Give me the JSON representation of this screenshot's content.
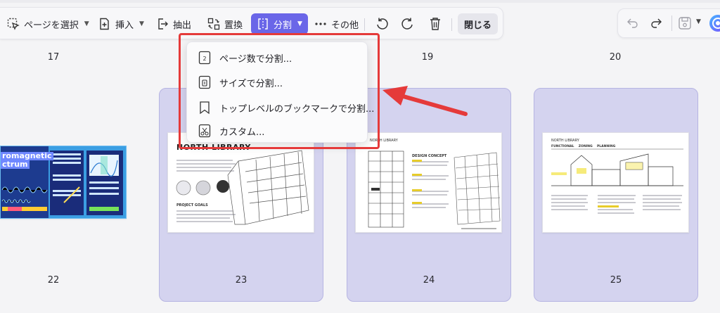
{
  "toolbar": {
    "select_page_label": "ページを選択",
    "insert_label": "挿入",
    "extract_label": "抽出",
    "replace_label": "置換",
    "split_label": "分割",
    "more_label": "その他",
    "close_label": "閉じる"
  },
  "split_menu": {
    "items": [
      {
        "label": "ページ数で分割..."
      },
      {
        "label": "サイズで分割..."
      },
      {
        "label": "トップレベルのブックマークで分割..."
      },
      {
        "label": "カスタム..."
      }
    ]
  },
  "pages": {
    "row1": [
      "17",
      "19",
      "20"
    ],
    "row2": [
      "22",
      "23",
      "24",
      "25"
    ]
  },
  "thumbnails": {
    "p22_title_line1": "romagnetic",
    "p22_title_line2": "ctrum",
    "p23_title": "NORTH LIBRARY",
    "p23_section": "PROJECT GOALS",
    "p24_header": "NORTH LIBRARY",
    "p24_section": "DESIGN CONCEPT",
    "p25_header": "NORTH LIBRARY",
    "p25_tabs": "FUNCTIONAL    ZONING    PLANNING"
  },
  "colors": {
    "accent": "#6a66e8",
    "selection_fill": "#d4d3ef",
    "annotation_red": "#e53a3a"
  }
}
